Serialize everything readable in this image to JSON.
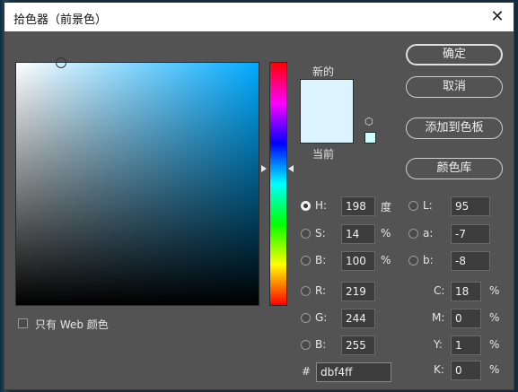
{
  "window": {
    "title": "拾色器（前景色）",
    "close_glyph": "✕"
  },
  "swatches": {
    "new_label": "新的",
    "current_label": "当前",
    "new_color": "#dbf4ff",
    "current_color": "#dbf4ff"
  },
  "buttons": {
    "ok": "确定",
    "cancel": "取消",
    "add_to_swatches": "添加到色板",
    "color_libraries": "颜色库"
  },
  "only_web_colors": {
    "label": "只有 Web 颜色",
    "checked": false
  },
  "hsb": {
    "h": {
      "label": "H:",
      "value": "198",
      "unit": "度",
      "selected": true
    },
    "s": {
      "label": "S:",
      "value": "14",
      "unit": "%"
    },
    "b": {
      "label": "B:",
      "value": "100",
      "unit": "%"
    }
  },
  "rgb": {
    "r": {
      "label": "R:",
      "value": "219"
    },
    "g": {
      "label": "G:",
      "value": "244"
    },
    "b": {
      "label": "B:",
      "value": "255"
    }
  },
  "lab": {
    "l": {
      "label": "L:",
      "value": "95"
    },
    "a": {
      "label": "a:",
      "value": "-7"
    },
    "b": {
      "label": "b:",
      "value": "-8"
    }
  },
  "cmyk": {
    "c": {
      "label": "C:",
      "value": "18",
      "unit": "%"
    },
    "m": {
      "label": "M:",
      "value": "0",
      "unit": "%"
    },
    "y": {
      "label": "Y:",
      "value": "1",
      "unit": "%"
    },
    "k": {
      "label": "K:",
      "value": "0",
      "unit": "%"
    }
  },
  "hex": {
    "label": "#",
    "value": "dbf4ff"
  }
}
